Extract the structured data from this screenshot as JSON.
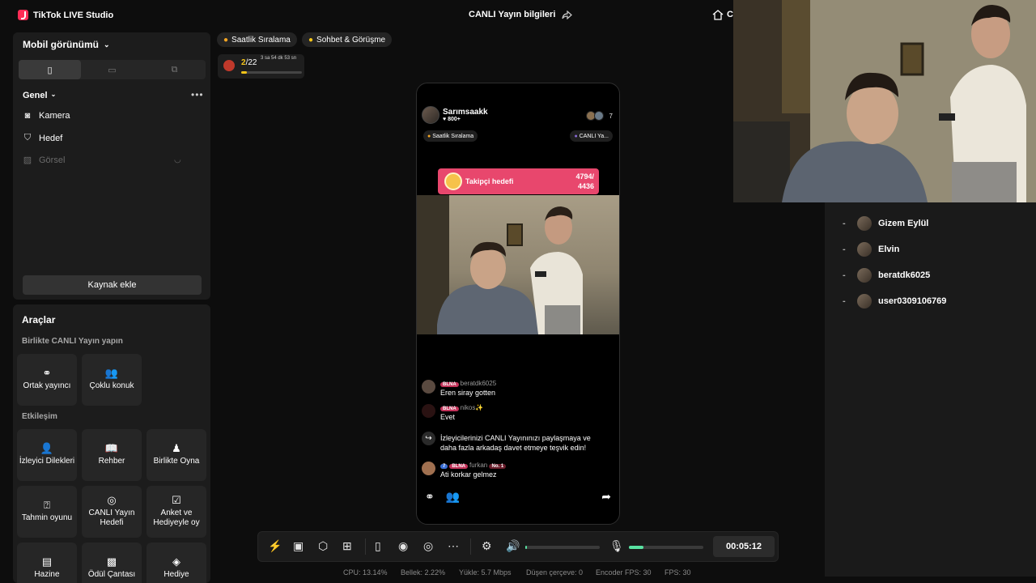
{
  "titlebar": {
    "app_title": "TikTok LIVE Studio",
    "live_info": "CANLI Yayın bilgileri",
    "home_label": "C"
  },
  "sources": {
    "view_mode": "Mobil görünümü",
    "group": "Genel",
    "items": [
      {
        "label": "Kamera",
        "icon": "camera-icon"
      },
      {
        "label": "Hedef",
        "icon": "shield-icon"
      },
      {
        "label": "Görsel",
        "icon": "image-icon"
      }
    ],
    "add_source": "Kaynak ekle"
  },
  "tools": {
    "title": "Araçlar",
    "collab_title": "Birlikte CANLI Yayın yapın",
    "collab": [
      {
        "label": "Ortak yayıncı",
        "icon": "link-icon"
      },
      {
        "label": "Çoklu konuk",
        "icon": "group-icon"
      }
    ],
    "engage_title": "Etkileşim",
    "engage": [
      {
        "label": "İzleyici Dilekleri",
        "icon": "viewer-wish-icon"
      },
      {
        "label": "Rehber",
        "icon": "guide-icon"
      },
      {
        "label": "Birlikte Oyna",
        "icon": "play-together-icon"
      },
      {
        "label": "Tahmin oyunu",
        "icon": "prediction-icon"
      },
      {
        "label": "CANLI Yayın Hedefi",
        "icon": "target-icon"
      },
      {
        "label": "Anket ve Hediyeyle oy",
        "icon": "poll-icon"
      },
      {
        "label": "Hazine",
        "icon": "treasure-icon"
      },
      {
        "label": "Ödül Çantası",
        "icon": "reward-bag-icon"
      },
      {
        "label": "Hediye",
        "icon": "gift-icon"
      }
    ]
  },
  "stage": {
    "pill_ranking": "Saatlik Sıralama",
    "pill_chat": "Sohbet & Görüşme",
    "mini_count": "2",
    "mini_total": "/22",
    "mini_time": "3 sa 54 dk 53 sn",
    "mini_progress": 0.09
  },
  "phone": {
    "host_name": "Sarımsaakk",
    "host_likes": "♥ 800+",
    "viewer_count": "7",
    "chip_ranking": "Saatlik Sıralama",
    "chip_live": "CANLI Ya...",
    "goal_label": "Takipçi hedefi",
    "goal_value": "4794/",
    "goal_total": "4436",
    "chat": [
      {
        "badges": [
          "BLNA"
        ],
        "user": "beratdk6025",
        "msg": "Eren siray gotten"
      },
      {
        "badges": [
          "BLNA"
        ],
        "user": "nikos✨",
        "msg": "Evet"
      },
      {
        "badges": [],
        "user": "",
        "msg": "İzleyicilerinizi CANLI Yayınınızı paylaşmaya ve daha fazla arkadaş davet etmeye teşvik edin!"
      },
      {
        "badges": [
          "7",
          "BLNA",
          "No. 1"
        ],
        "user": "furkan",
        "msg": "Ati korkar gelmez"
      }
    ]
  },
  "toolbar": {
    "timer": "00:05:12",
    "volume": 0.02,
    "mic": 0.2
  },
  "status": {
    "cpu": "CPU:  13.14%",
    "memory": "Bellek:  2.22%",
    "upload": "Yükle:  5.7 Mbps",
    "dropped": "Düşen çerçeve:  0",
    "encoder_fps": "Encoder FPS:  30",
    "fps": "FPS:  30"
  },
  "guests": [
    "Gizem Eylül",
    "Elvin",
    "beratdk6025",
    "user0309106769"
  ],
  "colors": {
    "accent_green": "#59e3a2",
    "brand_red": "#fe2c55",
    "goal_pink": "#e8476d"
  }
}
